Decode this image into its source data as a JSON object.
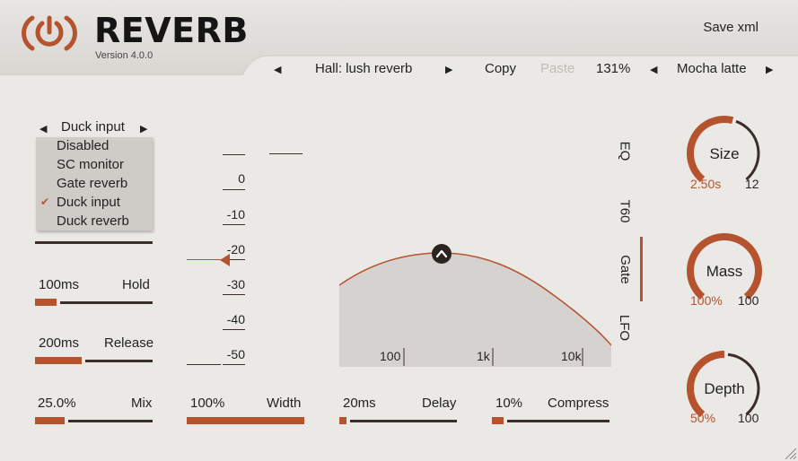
{
  "app": {
    "title": "REVERB",
    "version": "Version 4.0.0",
    "save_xml": "Save xml"
  },
  "toolbar": {
    "preset": "Hall: lush reverb",
    "copy": "Copy",
    "paste": "Paste",
    "zoom": "131%",
    "theme": "Mocha latte"
  },
  "duck": {
    "selected": "Duck input",
    "options": [
      "Disabled",
      "SC monitor",
      "Gate reverb",
      "Duck input",
      "Duck reverb"
    ],
    "checked_index": 3
  },
  "hold": {
    "value": "100ms",
    "label": "Hold",
    "level": 0.18
  },
  "release": {
    "value": "200ms",
    "label": "Release",
    "level": 0.4
  },
  "mix": {
    "value": "25.0%",
    "label": "Mix",
    "level": 0.25
  },
  "width": {
    "value": "100%",
    "label": "Width",
    "level": 1.0
  },
  "delay": {
    "value": "20ms",
    "label": "Delay",
    "level": 0.05
  },
  "compress": {
    "value": "10%",
    "label": "Compress",
    "level": 0.1
  },
  "meter": {
    "ticks": [
      "0",
      "-10",
      "-20",
      "-30",
      "-40",
      "-50"
    ]
  },
  "eq": {
    "freq_labels": [
      "100",
      "1k",
      "10k"
    ]
  },
  "tabs": [
    "EQ",
    "T60",
    "Gate",
    "LFO"
  ],
  "active_tab": "Gate",
  "knobs": {
    "size": {
      "label": "Size",
      "value": "2.50s",
      "max": "12",
      "level": 0.55
    },
    "mass": {
      "label": "Mass",
      "value": "100%",
      "max": "100",
      "level": 1.0
    },
    "depth": {
      "label": "Depth",
      "value": "50%",
      "max": "100",
      "level": 0.5
    }
  },
  "colors": {
    "accent": "#b5532e",
    "dark": "#3a2e2a",
    "background": "#ebe9e6"
  }
}
